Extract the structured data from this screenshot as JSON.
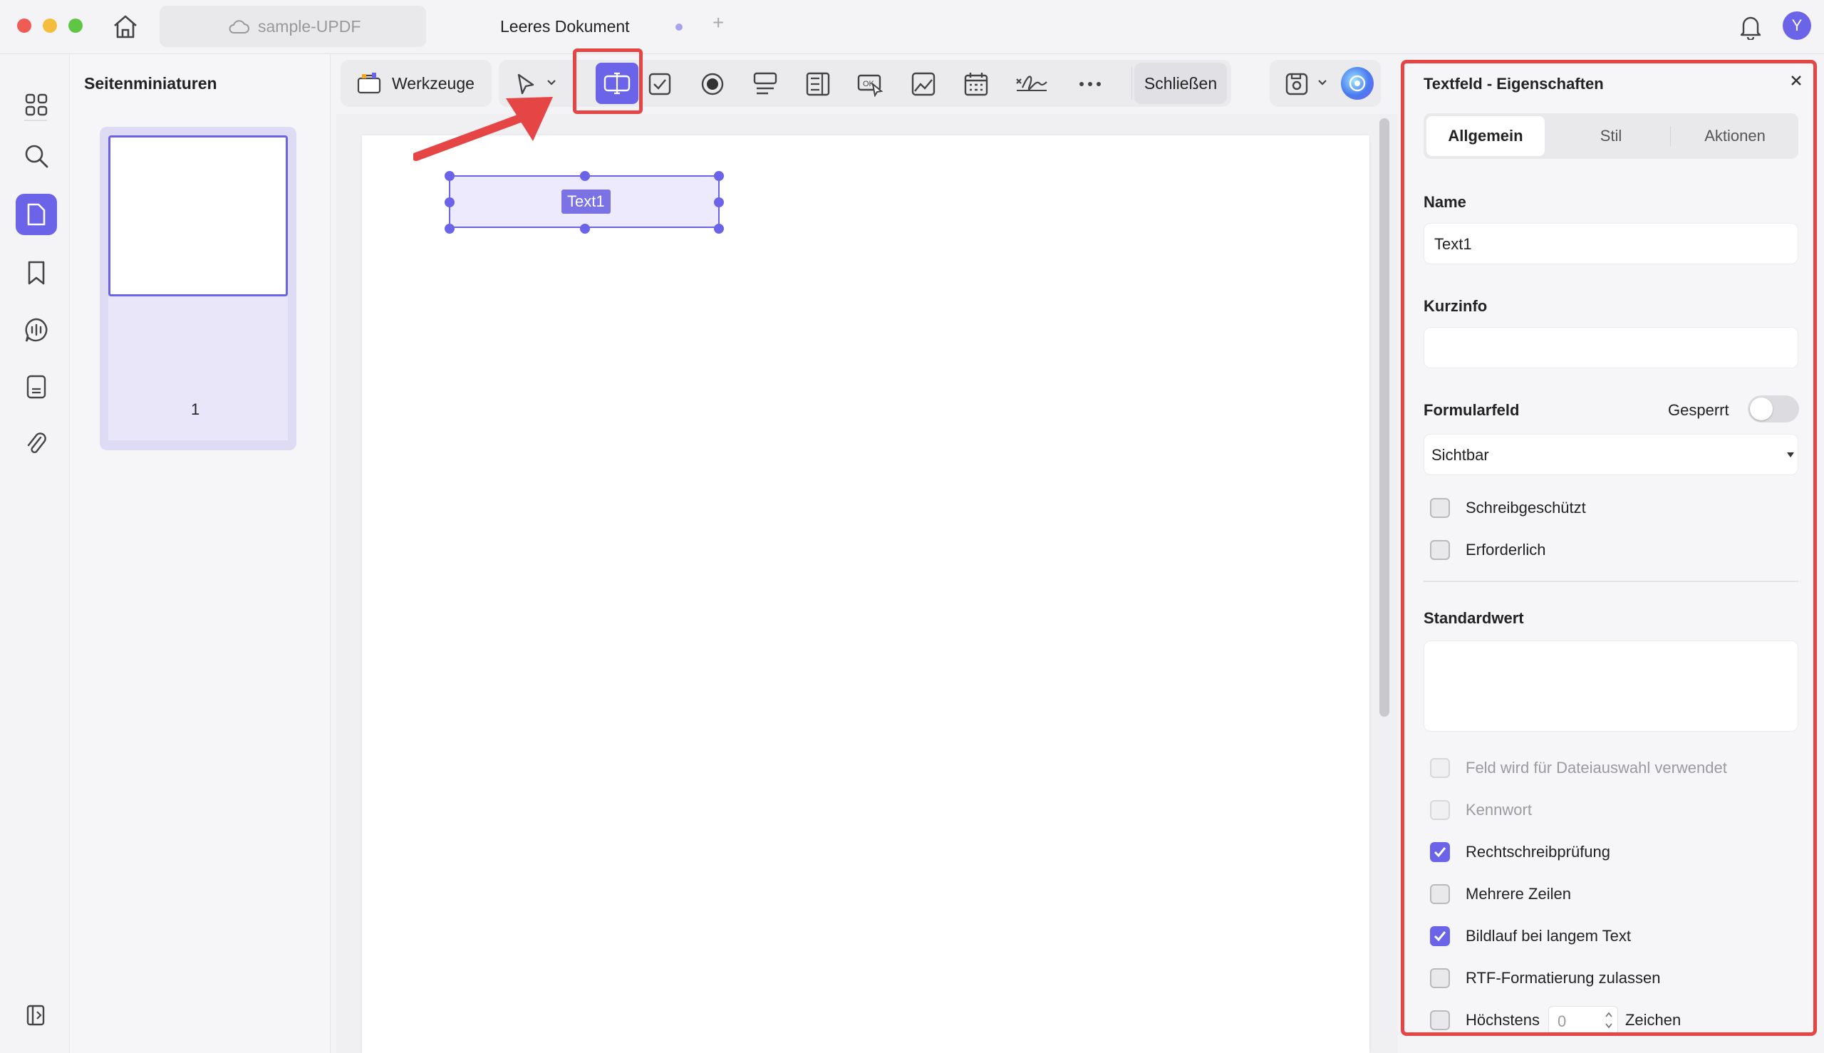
{
  "titlebar": {
    "tabs": [
      {
        "label": "sample-UPDF",
        "active": false
      },
      {
        "label": "Leeres Dokument",
        "active": true
      }
    ],
    "add_tab_label": "+",
    "avatar_letter": "Y"
  },
  "rail": {
    "items": [
      "grid-icon",
      "search-icon",
      "page-icon",
      "bookmark-icon",
      "ai-chat-icon",
      "document-icon",
      "attachment-icon"
    ],
    "active": "page-icon"
  },
  "thumbnails": {
    "title": "Seitenminiaturen",
    "pages": [
      {
        "number": "1"
      }
    ]
  },
  "toolbar": {
    "tools_label": "Werkzeuge",
    "close_label": "Schließen",
    "icons": [
      "select-icon",
      "text-field-icon",
      "checkbox-icon",
      "radio-icon",
      "list-box-icon",
      "dropdown-icon",
      "button-icon",
      "image-field-icon",
      "date-field-icon",
      "signature-icon",
      "more-icon"
    ],
    "active": "text-field-icon"
  },
  "document": {
    "field_label": "Text1"
  },
  "panel": {
    "title": "Textfeld - Eigenschaften",
    "tabs": [
      "Allgemein",
      "Stil",
      "Aktionen"
    ],
    "active_tab": "Allgemein",
    "name_label": "Name",
    "name_value": "Text1",
    "tooltip_label": "Kurzinfo",
    "tooltip_value": "",
    "form_field_label": "Formularfeld",
    "locked_label": "Gesperrt",
    "locked": false,
    "visibility_value": "Sichtbar",
    "checks_top": [
      {
        "label": "Schreibgeschützt",
        "checked": false
      },
      {
        "label": "Erforderlich",
        "checked": false
      }
    ],
    "default_label": "Standardwert",
    "default_value": "",
    "checks_bottom": [
      {
        "label": "Feld wird für Dateiauswahl verwendet",
        "checked": false,
        "disabled": true
      },
      {
        "label": "Kennwort",
        "checked": false,
        "disabled": true
      },
      {
        "label": "Rechtschreibprüfung",
        "checked": true,
        "disabled": false
      },
      {
        "label": "Mehrere Zeilen",
        "checked": false,
        "disabled": false
      },
      {
        "label": "Bildlauf bei langem Text",
        "checked": true,
        "disabled": false
      },
      {
        "label": "RTF-Formatierung zulassen",
        "checked": false,
        "disabled": false
      }
    ],
    "max_label": "Höchstens",
    "max_value": "0",
    "max_unit": "Zeichen"
  },
  "colors": {
    "accent": "#6b63e8",
    "highlight": "#e64545"
  }
}
